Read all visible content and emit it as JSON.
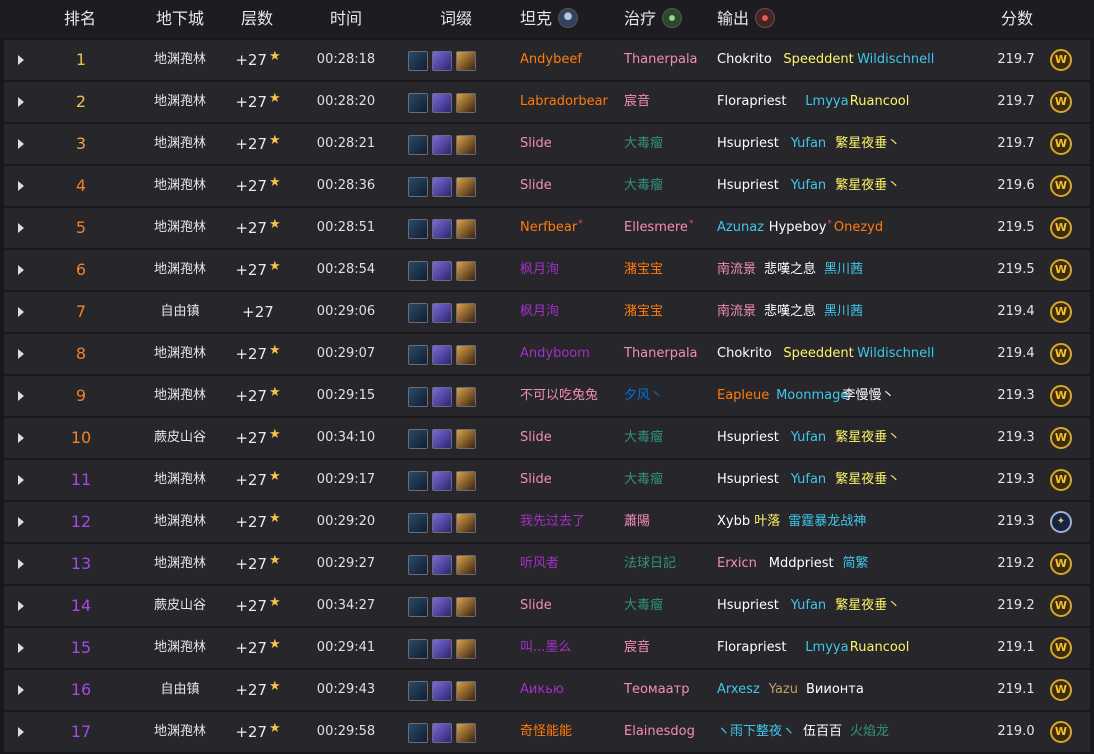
{
  "header": {
    "rank": "排名",
    "dungeon": "地下城",
    "level": "层数",
    "time": "时间",
    "affixes": "词缀",
    "tank": "坦克",
    "healer": "治疗",
    "dps": "输出",
    "score": "分数"
  },
  "icons": {
    "tank": "tank-role-icon",
    "healer": "healer-role-icon",
    "dps": "dps-role-icon",
    "star": "★",
    "horde": "W",
    "alliance": "✦"
  },
  "colors": {
    "rank_orange": "#f0822a",
    "rank_purple": "#a14be0",
    "rank_gold": "#e8c24a",
    "warrior": "#c89b6e",
    "paladin": "#f48cba",
    "druid": "#ff7c0a",
    "monk": "#00ff98",
    "priest": "#ffffff",
    "mage": "#3fc7eb",
    "evoker": "#33937f",
    "rogue": "#fff468",
    "shaman": "#0070dd",
    "demonhunter": "#a330c9"
  },
  "rows": [
    {
      "rank": "1",
      "rank_color": "#e8c24a",
      "dungeon": "地渊孢林",
      "level": "+27",
      "star": true,
      "time": "00:28:18",
      "tank": {
        "n": "Andybeef",
        "c": "#ff7c0a"
      },
      "healer": {
        "n": "Thanerpala",
        "c": "#f48cba"
      },
      "dps": [
        {
          "n": "Chokrito",
          "c": "#ffffff"
        },
        {
          "n": "Speeddent",
          "c": "#fff468"
        },
        {
          "n": "Wildischnell",
          "c": "#3fc7eb"
        }
      ],
      "score": "219.7",
      "faction": "horde"
    },
    {
      "rank": "2",
      "rank_color": "#e8c24a",
      "dungeon": "地渊孢林",
      "level": "+27",
      "star": true,
      "time": "00:28:20",
      "tank": {
        "n": "Labradorbear",
        "c": "#ff7c0a"
      },
      "healer": {
        "n": "宸音",
        "c": "#f48cba"
      },
      "dps": [
        {
          "n": "Florapriest",
          "c": "#ffffff"
        },
        {
          "n": "Lmyya",
          "c": "#3fc7eb"
        },
        {
          "n": "Ruancool",
          "c": "#fff468"
        }
      ],
      "score": "219.7",
      "faction": "horde"
    },
    {
      "rank": "3",
      "rank_color": "#f0a33a",
      "dungeon": "地渊孢林",
      "level": "+27",
      "star": true,
      "time": "00:28:21",
      "tank": {
        "n": "Slide",
        "c": "#f48cba"
      },
      "healer": {
        "n": "大毒瘤",
        "c": "#33937f"
      },
      "dps": [
        {
          "n": "Hsupriest",
          "c": "#ffffff"
        },
        {
          "n": "Yufan",
          "c": "#3fc7eb"
        },
        {
          "n": "繁星夜垂丶",
          "c": "#fff468"
        }
      ],
      "score": "219.7",
      "faction": "horde"
    },
    {
      "rank": "4",
      "rank_color": "#f0822a",
      "dungeon": "地渊孢林",
      "level": "+27",
      "star": true,
      "time": "00:28:36",
      "tank": {
        "n": "Slide",
        "c": "#f48cba"
      },
      "healer": {
        "n": "大毒瘤",
        "c": "#33937f"
      },
      "dps": [
        {
          "n": "Hsupriest",
          "c": "#ffffff"
        },
        {
          "n": "Yufan",
          "c": "#3fc7eb"
        },
        {
          "n": "繁星夜垂丶",
          "c": "#fff468"
        }
      ],
      "score": "219.6",
      "faction": "horde"
    },
    {
      "rank": "5",
      "rank_color": "#f0822a",
      "dungeon": "地渊孢林",
      "level": "+27",
      "star": true,
      "time": "00:28:51",
      "tank": {
        "n": "Nerfbear",
        "c": "#ff7c0a",
        "sup": "*"
      },
      "healer": {
        "n": "Ellesmere",
        "c": "#f48cba",
        "sup": "*"
      },
      "dps": [
        {
          "n": "Azunaz",
          "c": "#3fc7eb"
        },
        {
          "n": "Hypeboy",
          "c": "#ffffff",
          "sup": "*"
        },
        {
          "n": "Onezyd",
          "c": "#ff7c0a"
        }
      ],
      "score": "219.5",
      "faction": "horde"
    },
    {
      "rank": "6",
      "rank_color": "#f0822a",
      "dungeon": "地渊孢林",
      "level": "+27",
      "star": true,
      "time": "00:28:54",
      "tank": {
        "n": "枫月洵",
        "c": "#a330c9"
      },
      "healer": {
        "n": "潴宝宝",
        "c": "#ff7c0a"
      },
      "dps": [
        {
          "n": "南流景",
          "c": "#f48cba"
        },
        {
          "n": "悲嘆之息",
          "c": "#ffffff"
        },
        {
          "n": "黑川茜",
          "c": "#3fc7eb"
        }
      ],
      "score": "219.5",
      "faction": "horde"
    },
    {
      "rank": "7",
      "rank_color": "#f0822a",
      "dungeon": "自由镇",
      "level": "+27",
      "star": false,
      "time": "00:29:06",
      "tank": {
        "n": "枫月洵",
        "c": "#a330c9"
      },
      "healer": {
        "n": "潴宝宝",
        "c": "#ff7c0a"
      },
      "dps": [
        {
          "n": "南流景",
          "c": "#f48cba"
        },
        {
          "n": "悲嘆之息",
          "c": "#ffffff"
        },
        {
          "n": "黑川茜",
          "c": "#3fc7eb"
        }
      ],
      "score": "219.4",
      "faction": "horde"
    },
    {
      "rank": "8",
      "rank_color": "#f0822a",
      "dungeon": "地渊孢林",
      "level": "+27",
      "star": true,
      "time": "00:29:07",
      "tank": {
        "n": "Andyboom",
        "c": "#a330c9"
      },
      "healer": {
        "n": "Thanerpala",
        "c": "#f48cba"
      },
      "dps": [
        {
          "n": "Chokrito",
          "c": "#ffffff"
        },
        {
          "n": "Speeddent",
          "c": "#fff468"
        },
        {
          "n": "Wildischnell",
          "c": "#3fc7eb"
        }
      ],
      "score": "219.4",
      "faction": "horde"
    },
    {
      "rank": "9",
      "rank_color": "#f0822a",
      "dungeon": "地渊孢林",
      "level": "+27",
      "star": true,
      "time": "00:29:15",
      "tank": {
        "n": "不可以吃兔兔",
        "c": "#f48cba"
      },
      "healer": {
        "n": "夕风丶",
        "c": "#0070dd"
      },
      "dps": [
        {
          "n": "Eapleue",
          "c": "#ff7c0a"
        },
        {
          "n": "Moonmage",
          "c": "#3fc7eb"
        },
        {
          "n": "李慢慢丶",
          "c": "#ffffff"
        }
      ],
      "score": "219.3",
      "faction": "horde"
    },
    {
      "rank": "10",
      "rank_color": "#f0822a",
      "dungeon": "蕨皮山谷",
      "level": "+27",
      "star": true,
      "time": "00:34:10",
      "tank": {
        "n": "Slide",
        "c": "#f48cba"
      },
      "healer": {
        "n": "大毒瘤",
        "c": "#33937f"
      },
      "dps": [
        {
          "n": "Hsupriest",
          "c": "#ffffff"
        },
        {
          "n": "Yufan",
          "c": "#3fc7eb"
        },
        {
          "n": "繁星夜垂丶",
          "c": "#fff468"
        }
      ],
      "score": "219.3",
      "faction": "horde"
    },
    {
      "rank": "11",
      "rank_color": "#a14be0",
      "dungeon": "地渊孢林",
      "level": "+27",
      "star": true,
      "time": "00:29:17",
      "tank": {
        "n": "Slide",
        "c": "#f48cba"
      },
      "healer": {
        "n": "大毒瘤",
        "c": "#33937f"
      },
      "dps": [
        {
          "n": "Hsupriest",
          "c": "#ffffff"
        },
        {
          "n": "Yufan",
          "c": "#3fc7eb"
        },
        {
          "n": "繁星夜垂丶",
          "c": "#fff468"
        }
      ],
      "score": "219.3",
      "faction": "horde"
    },
    {
      "rank": "12",
      "rank_color": "#a14be0",
      "dungeon": "地渊孢林",
      "level": "+27",
      "star": true,
      "time": "00:29:20",
      "tank": {
        "n": "我先过去了",
        "c": "#a330c9"
      },
      "healer": {
        "n": "蕭陽",
        "c": "#f48cba"
      },
      "dps": [
        {
          "n": "Xybb",
          "c": "#ffffff"
        },
        {
          "n": "叶落",
          "c": "#fff468"
        },
        {
          "n": "雷霆暴龙战神",
          "c": "#3fc7eb"
        }
      ],
      "score": "219.3",
      "faction": "alliance"
    },
    {
      "rank": "13",
      "rank_color": "#a14be0",
      "dungeon": "地渊孢林",
      "level": "+27",
      "star": true,
      "time": "00:29:27",
      "tank": {
        "n": "听风者",
        "c": "#a330c9"
      },
      "healer": {
        "n": "法球日記",
        "c": "#33937f"
      },
      "dps": [
        {
          "n": "Erxicn",
          "c": "#f48cba"
        },
        {
          "n": "Mddpriest",
          "c": "#ffffff"
        },
        {
          "n": "简繁",
          "c": "#3fc7eb"
        }
      ],
      "score": "219.2",
      "faction": "horde"
    },
    {
      "rank": "14",
      "rank_color": "#a14be0",
      "dungeon": "蕨皮山谷",
      "level": "+27",
      "star": true,
      "time": "00:34:27",
      "tank": {
        "n": "Slide",
        "c": "#f48cba"
      },
      "healer": {
        "n": "大毒瘤",
        "c": "#33937f"
      },
      "dps": [
        {
          "n": "Hsupriest",
          "c": "#ffffff"
        },
        {
          "n": "Yufan",
          "c": "#3fc7eb"
        },
        {
          "n": "繁星夜垂丶",
          "c": "#fff468"
        }
      ],
      "score": "219.2",
      "faction": "horde"
    },
    {
      "rank": "15",
      "rank_color": "#a14be0",
      "dungeon": "地渊孢林",
      "level": "+27",
      "star": true,
      "time": "00:29:41",
      "tank": {
        "n": "叫...墨么",
        "c": "#a330c9"
      },
      "healer": {
        "n": "宸音",
        "c": "#f48cba"
      },
      "dps": [
        {
          "n": "Florapriest",
          "c": "#ffffff"
        },
        {
          "n": "Lmyya",
          "c": "#3fc7eb"
        },
        {
          "n": "Ruancool",
          "c": "#fff468"
        }
      ],
      "score": "219.1",
      "faction": "horde"
    },
    {
      "rank": "16",
      "rank_color": "#a14be0",
      "dungeon": "自由镇",
      "level": "+27",
      "star": true,
      "time": "00:29:43",
      "tank": {
        "n": "Аикью",
        "c": "#a330c9"
      },
      "healer": {
        "n": "Теомаатр",
        "c": "#f48cba"
      },
      "dps": [
        {
          "n": "Arxesz",
          "c": "#3fc7eb"
        },
        {
          "n": "Yazu",
          "c": "#c89b6e"
        },
        {
          "n": "Виионта",
          "c": "#ffffff"
        }
      ],
      "score": "219.1",
      "faction": "horde"
    },
    {
      "rank": "17",
      "rank_color": "#a14be0",
      "dungeon": "地渊孢林",
      "level": "+27",
      "star": true,
      "time": "00:29:58",
      "tank": {
        "n": "奇怪能能",
        "c": "#ff7c0a"
      },
      "healer": {
        "n": "Elainesdog",
        "c": "#f48cba"
      },
      "dps": [
        {
          "n": "ヽ雨下整夜ヽ",
          "c": "#3fc7eb"
        },
        {
          "n": "伍百百",
          "c": "#ffffff"
        },
        {
          "n": "火焰龙",
          "c": "#33937f"
        }
      ],
      "score": "219.0",
      "faction": "horde"
    }
  ]
}
